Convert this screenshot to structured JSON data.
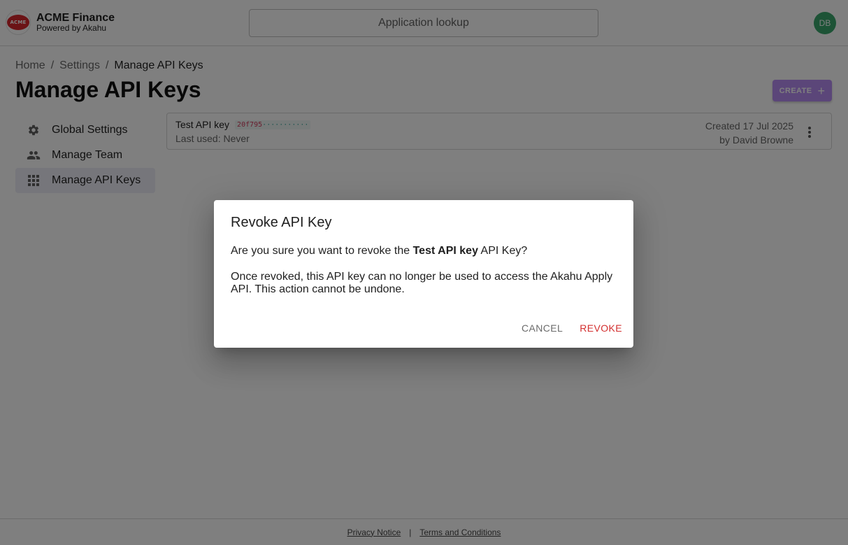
{
  "header": {
    "logo_text": "ACME",
    "brand_name": "ACME Finance",
    "brand_sub": "Powered by Akahu",
    "lookup_label": "Application lookup",
    "avatar_initials": "DB",
    "avatar_color": "#3aa76d"
  },
  "breadcrumb": {
    "items": [
      "Home",
      "Settings",
      "Manage API Keys"
    ],
    "separator": "/"
  },
  "page": {
    "title": "Manage API Keys",
    "create_label": "CREATE",
    "create_color": "#b68cf2"
  },
  "sidebar": {
    "items": [
      {
        "label": "Global Settings",
        "icon": "gear-icon"
      },
      {
        "label": "Manage Team",
        "icon": "people-icon"
      },
      {
        "label": "Manage API Keys",
        "icon": "grid-icon",
        "active": true
      }
    ]
  },
  "api_key": {
    "name": "Test API key",
    "token_prefix": "20f795",
    "token_mask": "···········",
    "last_used": "Last used: Never",
    "created": "Created 17 Jul 2025",
    "created_by": "by David Browne"
  },
  "dialog": {
    "title": "Revoke API Key",
    "question_pre": "Are you sure you want to revoke the ",
    "question_key": "Test API key",
    "question_post": " API Key?",
    "warning": "Once revoked, this API key can no longer be used to access the Akahu Apply API. This action cannot be undone.",
    "cancel_label": "CANCEL",
    "revoke_label": "REVOKE",
    "revoke_color": "#d32f2f"
  },
  "footer": {
    "privacy": "Privacy Notice",
    "separator": "|",
    "terms": "Terms and Conditions"
  }
}
